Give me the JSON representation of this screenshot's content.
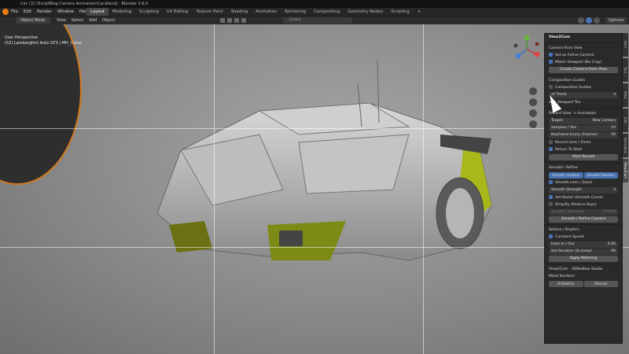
{
  "titlebar": {
    "title": "Car | [C:\\ScriptBlog Camera Animation\\Car.blend] - Blender 3.6.0"
  },
  "menu": [
    "File",
    "Edit",
    "Render",
    "Window",
    "Help"
  ],
  "workspaces": [
    "Layout",
    "Modeling",
    "Sculpting",
    "UV Editing",
    "Texture Paint",
    "Shading",
    "Animation",
    "Rendering",
    "Compositing",
    "Geometry Nodes",
    "Scripting",
    "+"
  ],
  "header": {
    "mode": "Object Mode",
    "menu": [
      "View",
      "Select",
      "Add",
      "Object"
    ],
    "transform": "Global",
    "options": "Options"
  },
  "viewport": {
    "info_line1": "User Perspective",
    "info_line2": "(52) Lamborghini Auto GT3 | MH_Curve"
  },
  "sidetabs": [
    "Item",
    "Tool",
    "View",
    "Edit",
    "Animation",
    "View2Cam"
  ],
  "panel": {
    "title": "View2Cam",
    "camera_from_view": "Camera from View",
    "set_active": "Set as Active Camera",
    "match_viewport": "Match Viewport (No Crop)",
    "create_btn": "Create Camera From View",
    "guides_head": "Composition Guides",
    "guides_cb": "Composition Guides",
    "thirds": "of Thirds",
    "in_viewport": "w in Viewport Too",
    "record_head": "Record View -> Animation",
    "target_label": "Target:",
    "target_value": "New Camera",
    "samples_label": "Samples / Sec",
    "samples_value": "10",
    "keyframe_label": "KeyFrame Every (Frames)",
    "keyframe_value": "50",
    "record_lens": "Record Lens / Zoom",
    "return_start": "Return To Start",
    "start_record": "Start Record",
    "smooth_head": "Smooth / Refine",
    "smooth_location": "Smooth Location",
    "smooth_rotation": "Smooth Rotation",
    "smooth_lens": "Smooth Lens / Zoom",
    "smooth_strength_label": "Smooth Strength",
    "smooth_strength_value": "3",
    "set_bezier": "Set Bezier (Smooth Curve)",
    "simplify": "Simplify (Reduce Keys)",
    "simplify_tol_label": "Simplify Tolerance",
    "simplify_tol_value": "0.0000",
    "smooth_btn": "Smooth / Refine Camera",
    "retime_head": "Retime / Rhythm",
    "constant_speed": "Constant Speed",
    "ease_label": "Ease In / Out",
    "ease_value": "0.00",
    "duration_label": "Set Duration (0=keep)",
    "duration_value": "90",
    "apply_btn": "Apply Retiming",
    "footer1": "View2Cam  -  3DRedbox Studio",
    "footer2": "Milad Kambari",
    "link1": "ArtStation",
    "link2": "Discord"
  },
  "colors": {
    "accent": "#4772b3",
    "panel": "#2a2a2a",
    "car_accent": "#b7c51a"
  }
}
